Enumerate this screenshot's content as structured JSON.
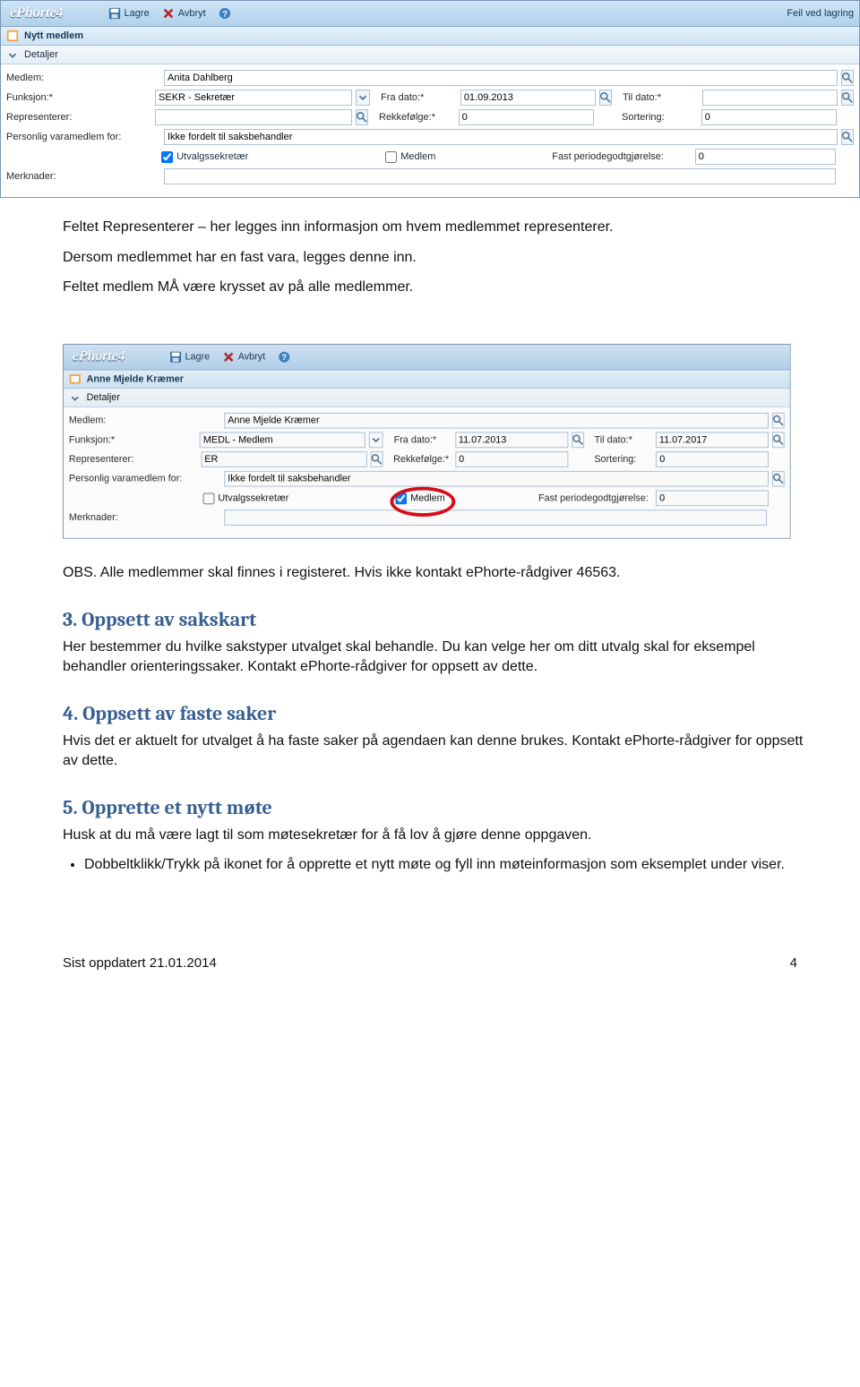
{
  "app1": {
    "logo": "ePhorte4",
    "toolbar": {
      "save": "Lagre",
      "cancel": "Avbryt",
      "right": "Feil ved lagring"
    },
    "subtitle": "Nytt medlem",
    "details_header": "Detaljer",
    "labels": {
      "medlem": "Medlem:",
      "funksjon": "Funksjon:*",
      "representerer": "Representerer:",
      "personlig": "Personlig varamedlem for:",
      "merknader": "Merknader:",
      "fra_dato": "Fra dato:*",
      "til_dato": "Til dato:*",
      "rekkefolge": "Rekkefølge:*",
      "sortering": "Sortering:",
      "utvalgssekretaer": "Utvalgssekretær",
      "medlem_chk": "Medlem",
      "fast_periode": "Fast periodegodtgjørelse:"
    },
    "values": {
      "medlem": "Anita Dahlberg",
      "funksjon": "SEKR - Sekretær",
      "representerer": "",
      "personlig": "Ikke fordelt til saksbehandler",
      "fra_dato": "01.09.2013",
      "til_dato": "",
      "rekkefolge": "0",
      "sortering": "0",
      "fast_periode": "0",
      "utvalgssekretaer_checked": true,
      "medlem_checked": false
    }
  },
  "body": {
    "p1": "Feltet Representerer – her legges inn informasjon om hvem medlemmet representerer.",
    "p2": "Dersom medlemmet har en fast vara, legges denne inn.",
    "p3": "Feltet medlem MÅ være krysset av på alle medlemmer.",
    "p4": "OBS. Alle medlemmer skal finnes i registeret. Hvis ikke kontakt ePhorte-rådgiver 46563.",
    "h3": "3. Oppsett av sakskart",
    "h3_p": "Her bestemmer du hvilke sakstyper utvalget skal behandle. Du kan velge her om ditt utvalg skal for eksempel behandler orienteringssaker. Kontakt ePhorte-rådgiver for oppsett av dette.",
    "h4": "4. Oppsett av faste saker",
    "h4_p": "Hvis det er aktuelt for utvalget å ha faste saker på agendaen kan denne brukes. Kontakt ePhorte-rådgiver for oppsett av dette.",
    "h5": "5. Opprette et nytt møte",
    "h5_p": "Husk at du må være lagt til som møtesekretær for å få lov å gjøre denne oppgaven.",
    "h5_li": "Dobbeltklikk/Trykk på ikonet for å opprette et nytt møte og fyll inn møteinformasjon som eksemplet under viser."
  },
  "app2": {
    "logo": "ePhorte4",
    "toolbar": {
      "save": "Lagre",
      "cancel": "Avbryt"
    },
    "subtitle": "Anne Mjelde Kræmer",
    "details_header": "Detaljer",
    "values": {
      "medlem": "Anne Mjelde Kræmer",
      "funksjon": "MEDL - Medlem",
      "representerer": "ER",
      "personlig": "Ikke fordelt til saksbehandler",
      "fra_dato": "11.07.2013",
      "til_dato": "11.07.2017",
      "rekkefolge": "0",
      "sortering": "0",
      "fast_periode": "0",
      "utvalgssekretaer_checked": false,
      "medlem_checked": true
    }
  },
  "footer": {
    "left": "Sist oppdatert 21.01.2014",
    "right": "4"
  }
}
